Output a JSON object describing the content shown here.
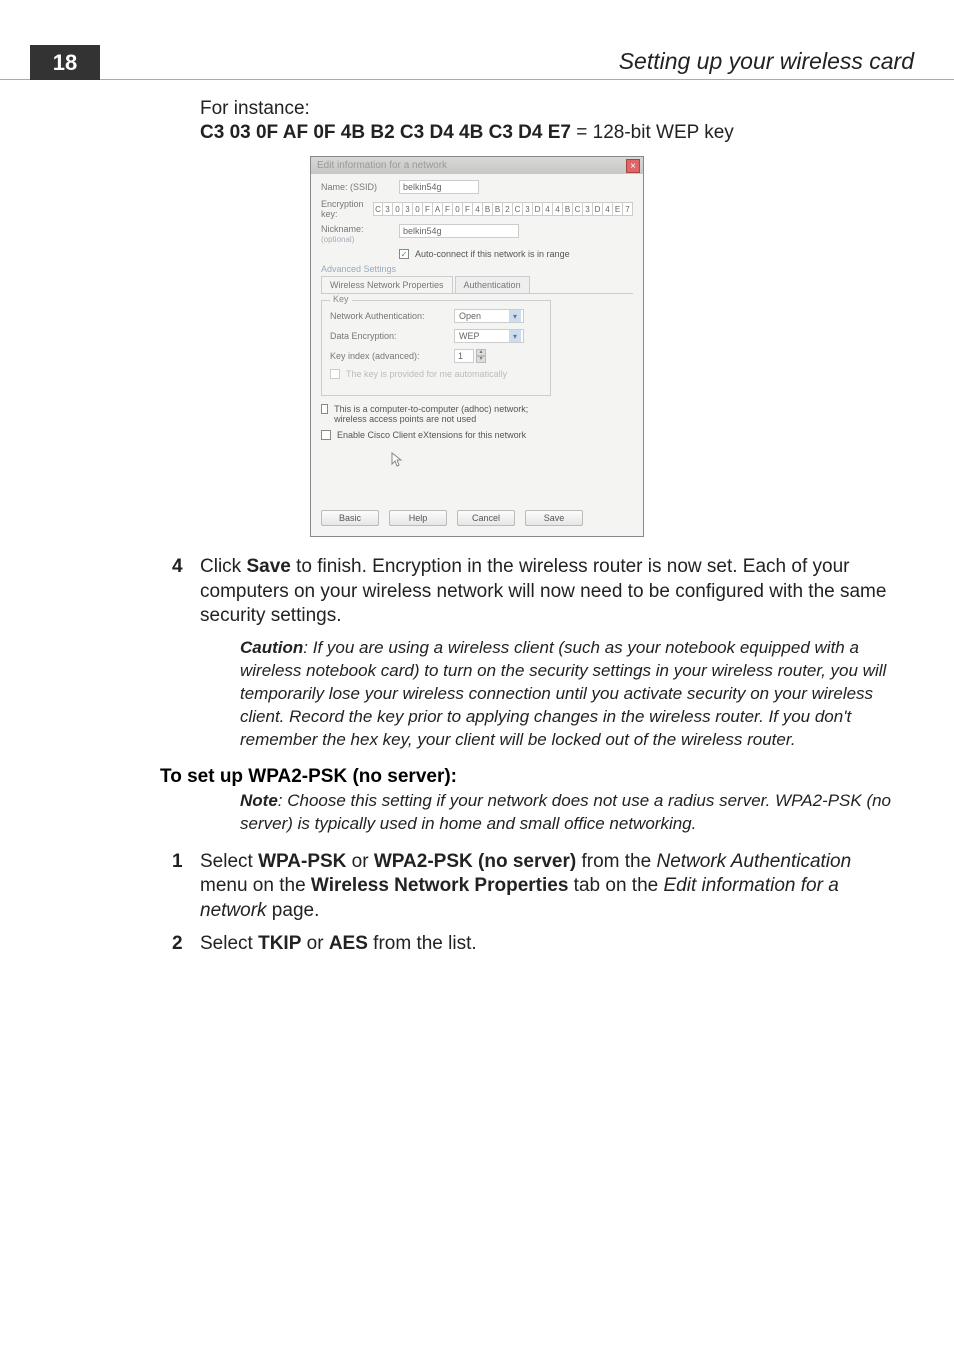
{
  "page_number": "18",
  "section_title": "Setting up your wireless card",
  "intro": "For instance:",
  "key_bold": "C3 03 0F AF 0F 4B B2 C3 D4 4B C3 D4 E7",
  "key_rest": " = 128-bit WEP key",
  "dialog": {
    "title": "Edit information for a network",
    "name_label": "Name: (SSID)",
    "name_value": "belkin54g",
    "enc_label": "Encryption key:",
    "enc_chars": [
      "C",
      "3",
      "0",
      "3",
      "0",
      "F",
      "A",
      "F",
      "0",
      "F",
      "4",
      "B",
      "B",
      "2",
      "C",
      "3",
      "D",
      "4",
      "4",
      "B",
      "C",
      "3",
      "D",
      "4",
      "E",
      "7"
    ],
    "nick_label": "Nickname:",
    "nick_opt": "(optional)",
    "nick_value": "belkin54g",
    "auto_connect": "Auto-connect if this network is in range",
    "adv_label": "Advanced Settings",
    "tab1": "Wireless Network Properties",
    "tab2": "Authentication",
    "group_title": "Key",
    "net_auth_label": "Network Authentication:",
    "net_auth_value": "Open",
    "data_enc_label": "Data Encryption:",
    "data_enc_value": "WEP",
    "key_index_label": "Key index (advanced):",
    "key_index_value": "1",
    "auto_key": "The key is provided for me automatically",
    "adhoc": "This is a computer-to-computer (adhoc) network; wireless access points are not used",
    "cisco": "Enable Cisco Client eXtensions for this network",
    "btn_basic": "Basic",
    "btn_help": "Help",
    "btn_cancel": "Cancel",
    "btn_save": "Save"
  },
  "step4": {
    "num": "4",
    "pre": "Click ",
    "save": "Save",
    "post": " to finish. Encryption in the wireless router is now set. Each of your computers on your wireless network will now need to be configured with the same security settings."
  },
  "caution": {
    "label": "Caution",
    "text": ": If you are using a wireless client (such as your notebook equipped with a wireless notebook card) to turn on the security settings in your wireless router, you will temporarily lose your wireless connection until you activate security on your wireless client. Record the key prior to applying changes in the wireless router. If you don't remember the hex key, your client will be locked out of the wireless router."
  },
  "heading2": "To set up WPA2-PSK (no server):",
  "note": {
    "label": "Note",
    "text": ": Choose this setting if your network does not use a radius server. WPA2-PSK (no server) is typically used in home and small office networking."
  },
  "step1": {
    "num": "1",
    "a": "Select ",
    "b": "WPA-PSK",
    "c": " or ",
    "d": "WPA2-PSK (no server)",
    "e": " from the ",
    "f": "Network Authentication",
    "g": " menu on the ",
    "h": "Wireless Network Properties",
    "i": " tab on the ",
    "j": "Edit information for a network",
    "k": " page."
  },
  "step2": {
    "num": "2",
    "a": "Select ",
    "b": "TKIP",
    "c": " or ",
    "d": "AES",
    "e": " from the list."
  }
}
